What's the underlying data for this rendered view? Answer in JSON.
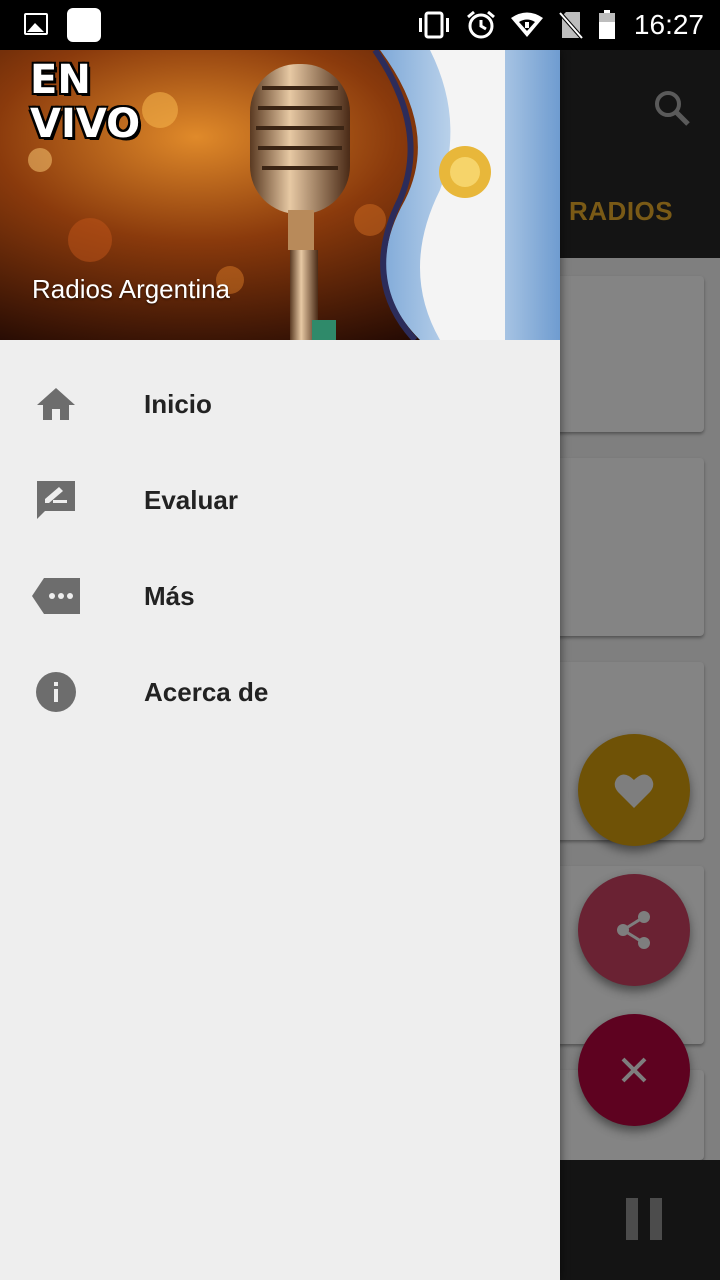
{
  "status_bar": {
    "time": "16:27",
    "icons": [
      "image-icon",
      "app-icon",
      "vibrate-icon",
      "alarm-icon",
      "wifi-icon",
      "no-sim-icon",
      "battery-icon"
    ]
  },
  "drawer": {
    "header": {
      "badge_text": "EN\nVIVO",
      "title": "Radios Argentina"
    },
    "items": [
      {
        "label": "Inicio",
        "icon": "home-icon"
      },
      {
        "label": "Evaluar",
        "icon": "rate-review-icon"
      },
      {
        "label": "Más",
        "icon": "more-icon"
      },
      {
        "label": "Acerca de",
        "icon": "info-icon"
      }
    ]
  },
  "background_app": {
    "tab_label": "RADIOS",
    "search_icon": "search-icon",
    "fab_icons": [
      "heart-icon",
      "share-icon",
      "close-icon"
    ],
    "player_icon": "pause-icon"
  },
  "colors": {
    "drawer_bg": "#eeeeee",
    "menu_icon": "#6d6d6d",
    "menu_text": "#222222",
    "tab_accent": "#7a5a16",
    "fab_favorite": "#6f5206",
    "fab_share": "#6a2233",
    "fab_close": "#5e0220"
  }
}
